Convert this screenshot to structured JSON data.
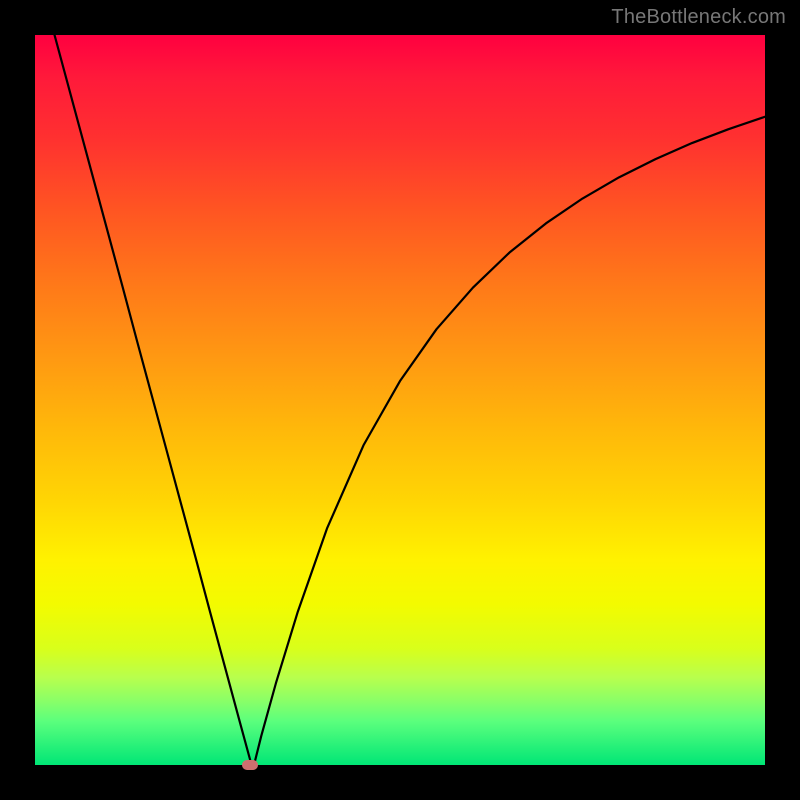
{
  "watermark": "TheBottleneck.com",
  "colors": {
    "frame": "#000000",
    "curve": "#000000",
    "marker": "#cc6f6f"
  },
  "chart_data": {
    "type": "line",
    "title": "",
    "xlabel": "",
    "ylabel": "",
    "xlim": [
      0,
      100
    ],
    "ylim": [
      0,
      100
    ],
    "grid": false,
    "annotations": [
      "TheBottleneck.com"
    ],
    "x": [
      0,
      2,
      4,
      6,
      8,
      10,
      12,
      14,
      16,
      18,
      20,
      22,
      24,
      26,
      28,
      29.5,
      30,
      31,
      33,
      36,
      40,
      45,
      50,
      55,
      60,
      65,
      70,
      75,
      80,
      85,
      90,
      95,
      100
    ],
    "values": [
      110,
      102.5,
      95.1,
      87.7,
      80.3,
      72.9,
      65.5,
      58.0,
      50.6,
      43.2,
      35.8,
      28.4,
      20.9,
      13.5,
      6.1,
      0.6,
      0.0,
      4.0,
      11.2,
      21.0,
      32.4,
      43.8,
      52.6,
      59.7,
      65.4,
      70.2,
      74.2,
      77.6,
      80.5,
      83.0,
      85.2,
      87.1,
      88.8
    ],
    "marker": {
      "x": 29.5,
      "y": 0.0
    }
  }
}
